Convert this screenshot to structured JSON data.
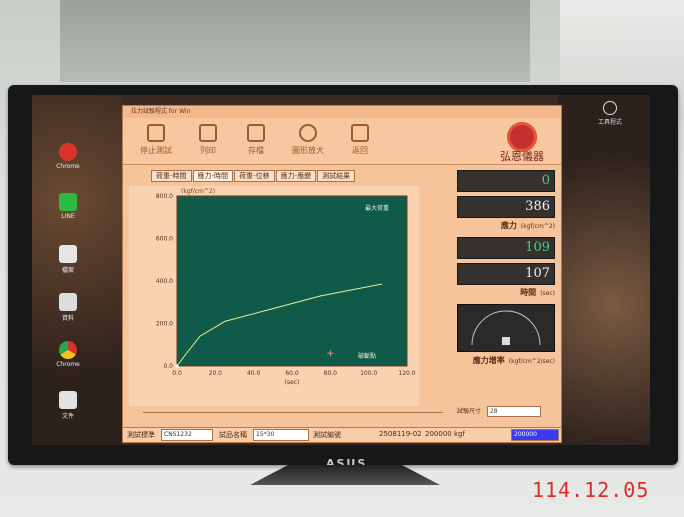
{
  "app": {
    "title": "拉力試驗程式 for Win",
    "toolbar": [
      {
        "label": "停止測試",
        "icon": "stop-icon"
      },
      {
        "label": "列印",
        "icon": "printer-icon"
      },
      {
        "label": "存檔",
        "icon": "save-icon"
      },
      {
        "label": "圖形放大",
        "icon": "zoom-icon"
      },
      {
        "label": "返回",
        "icon": "return-icon"
      }
    ],
    "logo_text": "弘恩儀器",
    "tabs": [
      "荷重-時間",
      "應力-時間",
      "荷重-位移",
      "應力-應變",
      "測試結果"
    ]
  },
  "chart_data": {
    "type": "line",
    "ylabel": "(kgf/cm^2)",
    "xlabel": "(sec)",
    "xlim": [
      0,
      120
    ],
    "ylim": [
      0,
      800
    ],
    "x_ticks": [
      "0.0",
      "20.0",
      "40.0",
      "60.0",
      "80.0",
      "100.0",
      "120.0"
    ],
    "y_ticks": [
      "0.0",
      "200.0",
      "400.0",
      "600.0",
      "800.0"
    ],
    "annotations": [
      "最大荷重",
      "破斷點"
    ],
    "series": [
      {
        "x": [
          0,
          5,
          12,
          25,
          50,
          75,
          107
        ],
        "y": [
          0,
          60,
          140,
          210,
          270,
          330,
          386
        ]
      }
    ],
    "marker_point": {
      "x": 80,
      "y": 60
    },
    "line_color": "#e8f0a0",
    "bg_color": "#0f5a48"
  },
  "panel": {
    "disp1": "0",
    "disp2": "386",
    "disp2_label": "應力",
    "disp2_unit": "(kgf/cm^2)",
    "disp3": "109",
    "disp4": "107",
    "disp4_label": "時間",
    "disp4_unit": "(sec)",
    "rate_label": "應力增率",
    "rate_unit": "(kgf/cm^2/sec)",
    "size_label": "試驗尺寸",
    "size_value": "28"
  },
  "status": {
    "standard_label": "測試標準",
    "standard_value": "CNS1232",
    "sample_label": "試品名稱",
    "sample_value": "15*30",
    "number_label": "測試編號",
    "number_value": "2508119-02",
    "capacity": "200000 kgf",
    "unit_value": "200000"
  },
  "desktop": {
    "icons": [
      "Chrome",
      "LINE",
      "檔案",
      "資料",
      "Chrome",
      "文件"
    ],
    "right_icon": "工具程式"
  },
  "photo": {
    "monitor_brand": "ASUS",
    "date_stamp": "114.12.05"
  }
}
